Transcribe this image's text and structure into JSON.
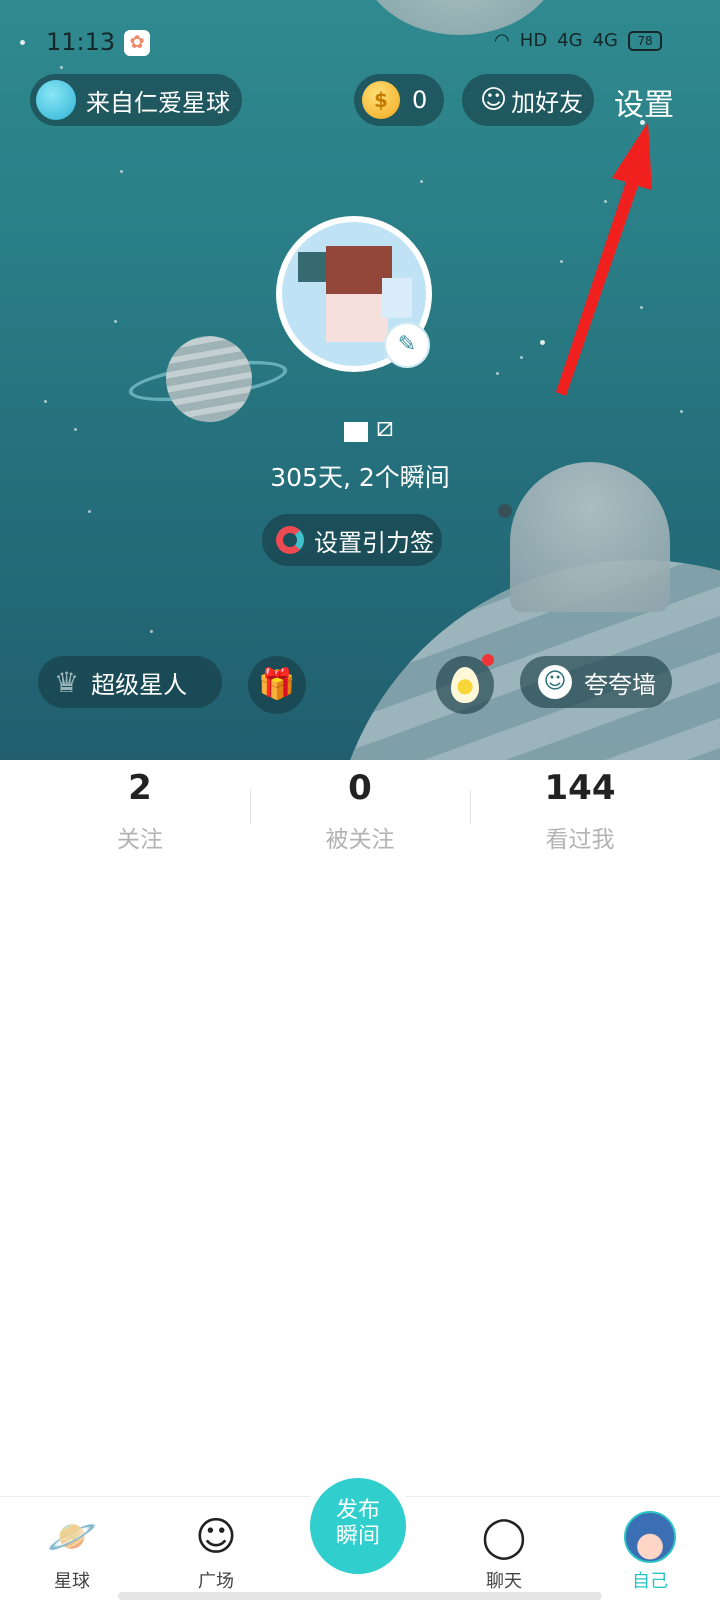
{
  "status_bar": {
    "time": "11:13",
    "network": "HD",
    "signal1": "4G",
    "signal2": "4G",
    "battery": "78"
  },
  "header": {
    "origin_label": "来自仁爱星球",
    "coins": "0",
    "add_friend": "加好友",
    "settings": "设置"
  },
  "profile": {
    "stats_text": "305天, 2个瞬间",
    "tag_button": "设置引力签",
    "vip_label": "超级星人",
    "praise_wall": "夸夸墙"
  },
  "counts": [
    {
      "value": "2",
      "label": "关注"
    },
    {
      "value": "0",
      "label": "被关注"
    },
    {
      "value": "144",
      "label": "看过我"
    }
  ],
  "bottom_nav": {
    "planet": "星球",
    "square": "广场",
    "publish_line1": "发布",
    "publish_line2": "瞬间",
    "chat": "聊天",
    "self": "自己"
  },
  "colors": {
    "accent": "#30cfce",
    "hero_bg": "#2a7d86",
    "annotation_arrow": "#f0201e"
  }
}
